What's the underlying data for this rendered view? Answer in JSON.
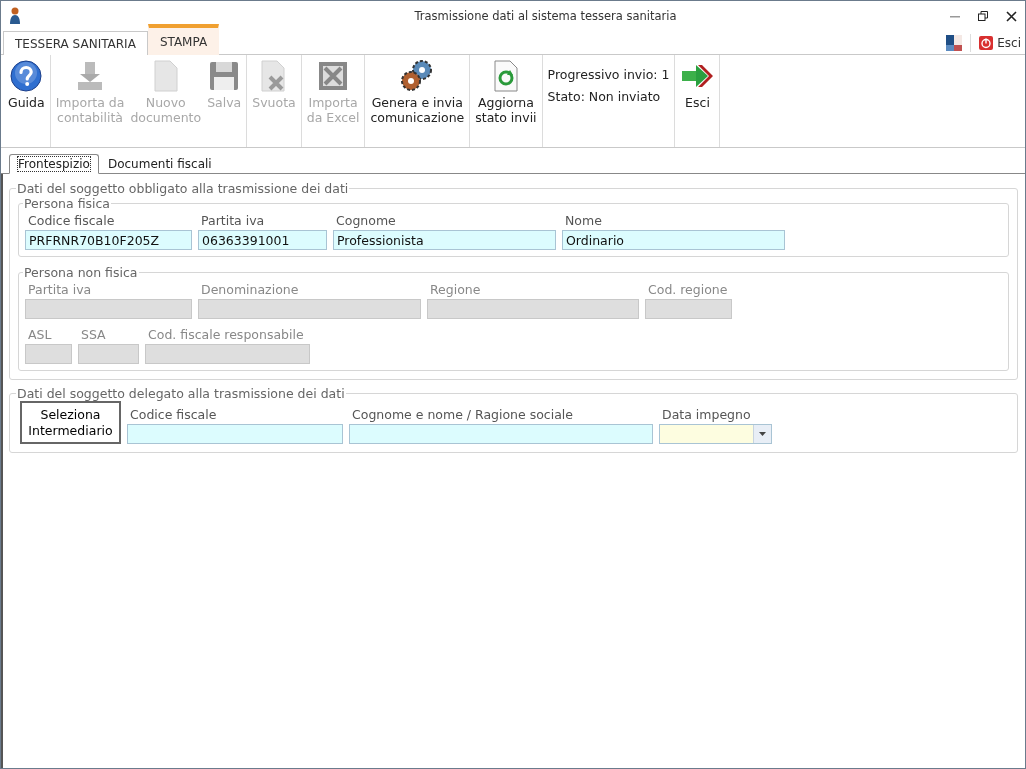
{
  "window": {
    "title": "Trasmissione dati al sistema tessera sanitaria"
  },
  "ribbon_tabs": [
    {
      "label": "TESSERA SANITARIA",
      "selected": true
    },
    {
      "label": "STAMPA",
      "selected": false
    }
  ],
  "header_exit": {
    "label": "Esci"
  },
  "toolbar": [
    {
      "kind": "buttons",
      "items": [
        {
          "label": "Guida",
          "disabled": false
        }
      ]
    },
    {
      "kind": "buttons",
      "items": [
        {
          "label": "Importa da\ncontabilità",
          "disabled": true
        },
        {
          "label": "Nuovo\ndocumento",
          "disabled": true
        },
        {
          "label": "Salva",
          "disabled": true
        }
      ]
    },
    {
      "kind": "buttons",
      "items": [
        {
          "label": "Svuota",
          "disabled": true
        }
      ]
    },
    {
      "kind": "buttons",
      "items": [
        {
          "label": "Importa\nda Excel",
          "disabled": true
        }
      ]
    },
    {
      "kind": "buttons",
      "items": [
        {
          "label": "Genera e invia\ncomunicazione",
          "disabled": false
        }
      ]
    },
    {
      "kind": "buttons",
      "items": [
        {
          "label": "Aggiorna\nstato invii",
          "disabled": false
        }
      ]
    },
    {
      "kind": "status",
      "lines": [
        "Progressivo invio: 1",
        "Stato: Non inviato"
      ]
    },
    {
      "kind": "buttons",
      "items": [
        {
          "label": "Esci",
          "disabled": false
        }
      ]
    }
  ],
  "doc_tabs": [
    {
      "label": "Frontespizio",
      "selected": true
    },
    {
      "label": "Documenti fiscali",
      "selected": false
    }
  ],
  "obbligato": {
    "title": "Dati del soggetto obbligato alla trasmissione dei dati",
    "groups": [
      {
        "title": "Persona fisica",
        "lines": [
          {
            "fields": [
              {
                "label": "Codice fiscale",
                "value": "PRFRNR70B10F205Z",
                "disabled": false
              },
              {
                "label": "Partita iva",
                "value": "06363391001",
                "disabled": false
              },
              {
                "label": "Cognome",
                "value": "Professionista",
                "disabled": false
              },
              {
                "label": "Nome",
                "value": "Ordinario",
                "disabled": false
              }
            ]
          }
        ]
      },
      {
        "title": "Persona non fisica",
        "lines": [
          {
            "fields": [
              {
                "label": "Partita iva",
                "disabled": true
              },
              {
                "label": "Denominazione",
                "disabled": true
              },
              {
                "label": "Regione",
                "disabled": true
              },
              {
                "label": "Cod. regione",
                "disabled": true
              }
            ]
          },
          {
            "fields": [
              {
                "label": "ASL",
                "disabled": true
              },
              {
                "label": "SSA",
                "disabled": true
              },
              {
                "label": "Cod. fiscale responsabile",
                "disabled": true
              }
            ]
          }
        ]
      }
    ]
  },
  "delegato": {
    "title": "Dati del soggetto delegato alla trasmissione dei dati",
    "button": "Seleziona\nIntermediario",
    "fields": [
      {
        "label": "Codice fiscale",
        "kind": "text",
        "disabled": false
      },
      {
        "label": "Cognome e nome / Ragione sociale",
        "kind": "text",
        "disabled": false
      },
      {
        "label": "Data impegno",
        "kind": "date",
        "disabled": false
      }
    ]
  }
}
